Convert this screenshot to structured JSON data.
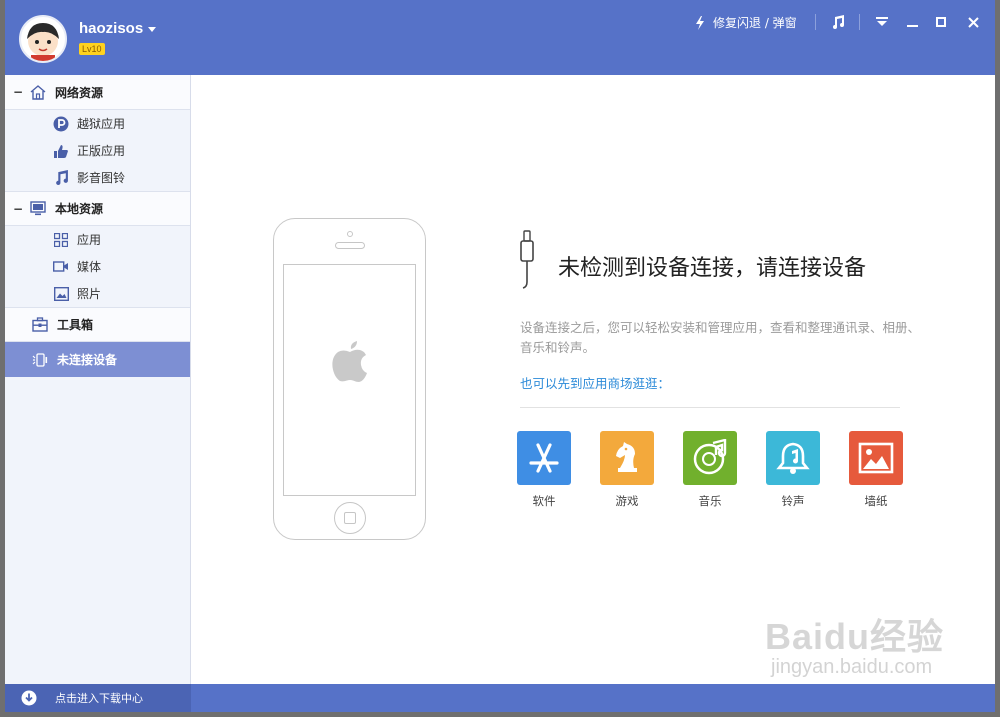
{
  "header": {
    "username": "haozisos",
    "level": "Lv10",
    "repair_label": "修复闪退 / 弹窗"
  },
  "sidebar": {
    "groups": [
      {
        "label": "网络资源",
        "items": [
          {
            "label": "越狱应用"
          },
          {
            "label": "正版应用"
          },
          {
            "label": "影音图铃"
          }
        ]
      },
      {
        "label": "本地资源",
        "items": [
          {
            "label": "应用"
          },
          {
            "label": "媒体"
          },
          {
            "label": "照片"
          }
        ]
      }
    ],
    "toolbox_label": "工具箱",
    "device_label": "未连接设备"
  },
  "footer": {
    "download_label": "点击进入下载中心"
  },
  "main": {
    "headline": "未检测到设备连接，请连接设备",
    "description": "设备连接之后，您可以轻松安装和管理应用，查看和整理通讯录、相册、音乐和铃声。",
    "store_link": "也可以先到应用商场逛逛：",
    "categories": [
      {
        "label": "软件",
        "color": "#3f8ee4",
        "icon": "app-store-icon"
      },
      {
        "label": "游戏",
        "color": "#f3a93c",
        "icon": "chess-knight-icon"
      },
      {
        "label": "音乐",
        "color": "#71b02d",
        "icon": "music-disc-icon"
      },
      {
        "label": "铃声",
        "color": "#3cb8d8",
        "icon": "bell-icon"
      },
      {
        "label": "墙纸",
        "color": "#e65a3c",
        "icon": "picture-icon"
      }
    ]
  },
  "watermark": {
    "brand": "Baidu经验",
    "url": "jingyan.baidu.com"
  },
  "colors": {
    "header": "#5672c8",
    "sidebar_active": "#7d8fd3",
    "link": "#2b8ad8"
  }
}
